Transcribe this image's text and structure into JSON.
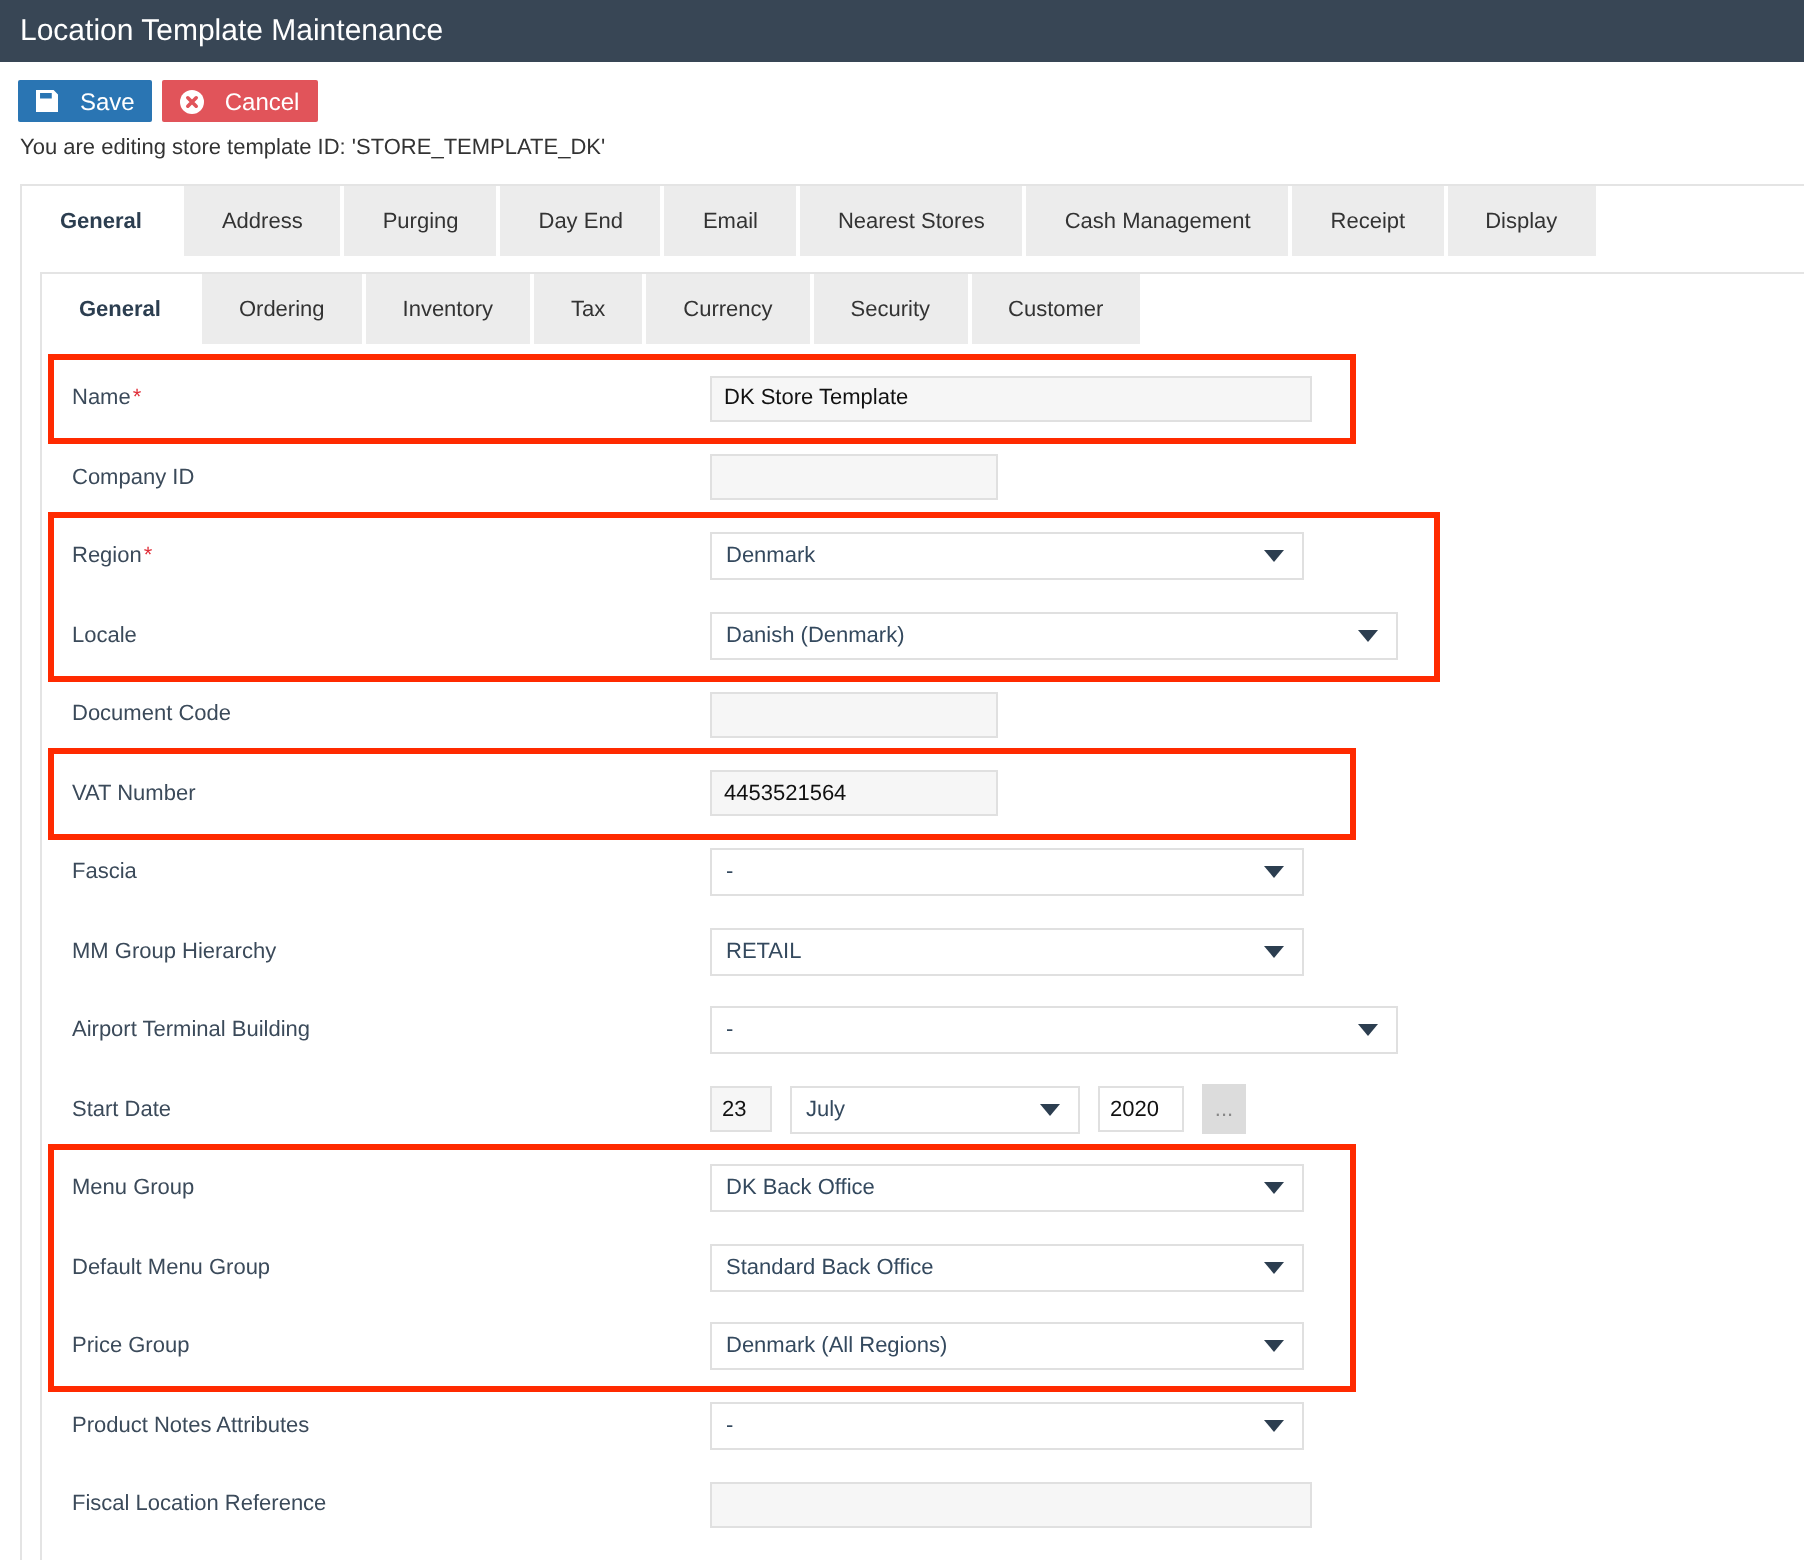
{
  "window": {
    "title": "Location Template Maintenance"
  },
  "toolbar": {
    "buttons": [
      {
        "kind": "save",
        "label": "Save"
      },
      {
        "kind": "cancel",
        "label": "Cancel"
      }
    ]
  },
  "info": "You are editing store template ID: 'STORE_TEMPLATE_DK'",
  "tabs": [
    {
      "label": "General",
      "selected": true
    },
    {
      "label": "Address",
      "selected": false
    },
    {
      "label": "Purging",
      "selected": false
    },
    {
      "label": "Day End",
      "selected": false
    },
    {
      "label": "Email",
      "selected": false
    },
    {
      "label": "Nearest Stores",
      "selected": false
    },
    {
      "label": "Cash Management",
      "selected": false
    },
    {
      "label": "Receipt",
      "selected": false
    },
    {
      "label": "Display",
      "selected": false
    }
  ],
  "subtabs": [
    {
      "label": "General",
      "selected": true
    },
    {
      "label": "Ordering",
      "selected": false
    },
    {
      "label": "Inventory",
      "selected": false
    },
    {
      "label": "Tax",
      "selected": false
    },
    {
      "label": "Currency",
      "selected": false
    },
    {
      "label": "Security",
      "selected": false
    },
    {
      "label": "Customer",
      "selected": false
    }
  ],
  "form": {
    "groups": [
      {
        "highlighted": true,
        "fields": [
          {
            "label": "Name",
            "required_mark": "*",
            "kind": "text",
            "value": "DK Store Template"
          }
        ]
      },
      {
        "highlighted": false,
        "fields": [
          {
            "label": "Company ID",
            "kind": "shorttext"
          }
        ]
      },
      {
        "highlighted": true,
        "fields": [
          {
            "label": "Region",
            "required_mark": "*",
            "kind": "dropdown",
            "value": "Denmark"
          },
          {
            "label": "Locale",
            "kind": "widedropdown",
            "value": "Danish (Denmark)"
          }
        ]
      },
      {
        "highlighted": false,
        "fields": [
          {
            "label": "Document Code",
            "kind": "shorttext"
          }
        ]
      },
      {
        "highlighted": true,
        "fields": [
          {
            "label": "VAT Number",
            "kind": "shorttext",
            "value": "4453521564"
          }
        ]
      },
      {
        "highlighted": false,
        "fields": [
          {
            "label": "Fascia",
            "kind": "dropdown",
            "value": "-"
          },
          {
            "label": "MM Group Hierarchy",
            "kind": "dropdown",
            "value": "RETAIL"
          },
          {
            "label": "Airport Terminal Building",
            "kind": "widedropdown",
            "value": "-"
          },
          {
            "label": "Start Date",
            "kind": "date",
            "day": "23",
            "month": "July",
            "year": "2020",
            "picker": "..."
          }
        ]
      },
      {
        "highlighted": true,
        "fields": [
          {
            "label": "Menu Group",
            "kind": "dropdown",
            "value": "DK Back Office"
          },
          {
            "label": "Default Menu Group",
            "kind": "dropdown",
            "value": "Standard Back Office"
          },
          {
            "label": "Price Group",
            "kind": "dropdown",
            "value": "Denmark (All Regions)"
          }
        ]
      },
      {
        "highlighted": false,
        "fields": [
          {
            "label": "Product Notes Attributes",
            "kind": "dropdown",
            "value": "-"
          },
          {
            "label": "Fiscal Location Reference",
            "kind": "text"
          }
        ]
      }
    ]
  }
}
